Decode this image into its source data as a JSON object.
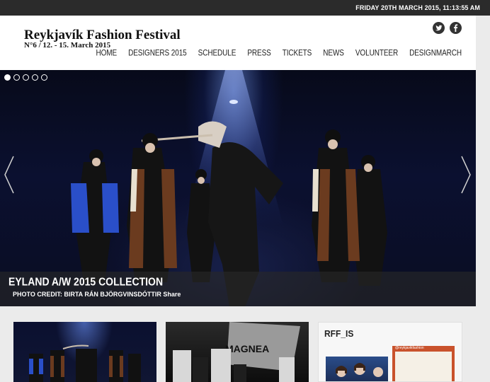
{
  "topbar": {
    "datetime": "FRIDAY 20TH MARCH 2015, 11:13:55 AM"
  },
  "header": {
    "title": "Reykjavík Fashion Festival",
    "subtitle": "N°6 / 12. - 15. March 2015",
    "social": [
      "twitter-icon",
      "facebook-icon"
    ]
  },
  "nav": {
    "items": [
      {
        "label": "HOME"
      },
      {
        "label": "DESIGNERS 2015"
      },
      {
        "label": "SCHEDULE"
      },
      {
        "label": "PRESS"
      },
      {
        "label": "TICKETS"
      },
      {
        "label": "NEWS"
      },
      {
        "label": "VOLUNTEER"
      },
      {
        "label": "DESIGNMARCH"
      }
    ]
  },
  "hero": {
    "slide_count": 5,
    "active_slide": 1,
    "caption_title": "EYLAND A/W 2015 COLLECTION",
    "caption_credit": "PHOTO CREDIT: BIRTA RÁN BJÖRGVINSDÓTTIR Share"
  },
  "cards": {
    "card2_sign": "MAGNEA",
    "rff_label": "RFF_IS",
    "insta_handle": "@reykjavikfashion"
  },
  "colors": {
    "topbar": "#2b2b2b",
    "header": "#ffffff",
    "page": "#ebebeb"
  }
}
